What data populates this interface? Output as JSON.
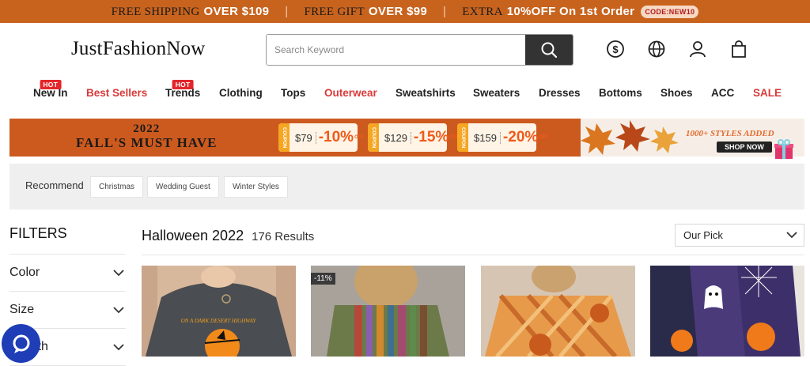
{
  "promo": {
    "seg1_text": "FREE SHIPPING",
    "seg1_hl": "OVER $109",
    "seg2_text": "FREE GIFT",
    "seg2_hl": "OVER $99",
    "seg3_text": "EXTRA",
    "seg3_hl": "10%OFF On 1st Order",
    "code": "CODE:NEW10",
    "separator": "|"
  },
  "header": {
    "logo": "JustFashionNow",
    "search_placeholder": "Search Keyword",
    "icons": [
      "search-icon",
      "currency-icon",
      "globe-icon",
      "user-icon",
      "bag-icon"
    ]
  },
  "nav": {
    "items": [
      {
        "label": "New In",
        "hot": "HOT"
      },
      {
        "label": "Best Sellers"
      },
      {
        "label": "Trends",
        "hot": "HOT"
      },
      {
        "label": "Clothing"
      },
      {
        "label": "Tops"
      },
      {
        "label": "Outerwear"
      },
      {
        "label": "Sweatshirts"
      },
      {
        "label": "Sweaters"
      },
      {
        "label": "Dresses"
      },
      {
        "label": "Bottoms"
      },
      {
        "label": "Shoes"
      },
      {
        "label": "ACC"
      },
      {
        "label": "SALE"
      }
    ]
  },
  "banner": {
    "year": "2022",
    "title": "FALL'S MUST HAVE",
    "coupons": [
      {
        "tab": "COUPON",
        "price": "$79",
        "pct": "-10%",
        "off": "OFF"
      },
      {
        "tab": "COUPON",
        "price": "$129",
        "pct": "-15%",
        "off": "OFF"
      },
      {
        "tab": "COUPON",
        "price": "$159",
        "pct": "-20%",
        "off": "OFF"
      }
    ],
    "styles_added": "1000+ STYLES ADDED",
    "shop_now": "SHOP NOW"
  },
  "recommend": {
    "label": "Recommend",
    "tags": [
      "Christmas",
      "Wedding Guest",
      "Winter Styles"
    ]
  },
  "filters": {
    "title": "FILTERS",
    "items": [
      "Color",
      "Size",
      "Length"
    ]
  },
  "results": {
    "title": "Halloween 2022",
    "count": "176 Results",
    "sort": "Our Pick",
    "product1_print": "ON A DARK DESERT HIGHWAY",
    "product2_discount": "-11%"
  },
  "colors": {
    "promo_bg": "#c8631e",
    "banner_bg": "#cc5a1f",
    "accent_red": "#d93a3a",
    "chat_blue": "#1e3db7"
  }
}
